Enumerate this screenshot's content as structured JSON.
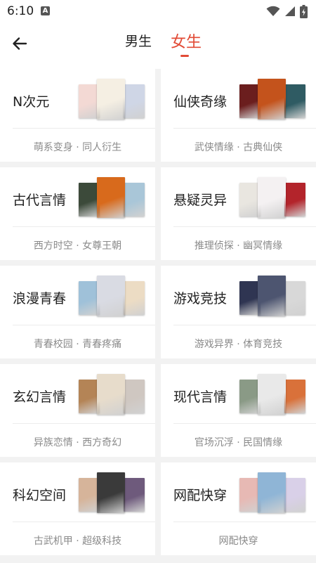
{
  "status": {
    "time": "6:10",
    "notification_icon": "A"
  },
  "header": {
    "tabs": [
      {
        "label": "男生",
        "active": false
      },
      {
        "label": "女生",
        "active": true
      }
    ]
  },
  "accent_color": "#e24b36",
  "categories": [
    {
      "title": "N次元",
      "tags": "萌系变身 · 同人衍生",
      "cover_colors": [
        "#f3d9d4",
        "#f5efe3",
        "#cfd6e6"
      ]
    },
    {
      "title": "仙侠奇缘",
      "tags": "武侠情缘 · 古典仙侠",
      "cover_colors": [
        "#6b1e1e",
        "#c4531c",
        "#2f5b63"
      ]
    },
    {
      "title": "古代言情",
      "tags": "西方时空 · 女尊王朝",
      "cover_colors": [
        "#3c4a3a",
        "#d86a1c",
        "#a9c6d8"
      ]
    },
    {
      "title": "悬疑灵异",
      "tags": "推理侦探 · 幽冥情缘",
      "cover_colors": [
        "#e9e6e0",
        "#f4f1f2",
        "#b3242b"
      ]
    },
    {
      "title": "浪漫青春",
      "tags": "青春校园 · 青春疼痛",
      "cover_colors": [
        "#9fc1d9",
        "#d9dbe3",
        "#ecdcc4"
      ]
    },
    {
      "title": "游戏竞技",
      "tags": "游戏异界 · 体育竞技",
      "cover_colors": [
        "#2f3552",
        "#4d5570",
        "#d8d8d8"
      ]
    },
    {
      "title": "玄幻言情",
      "tags": "异族恋情 · 西方奇幻",
      "cover_colors": [
        "#b48456",
        "#e7dccb",
        "#cfc7c1"
      ]
    },
    {
      "title": "现代言情",
      "tags": "官场沉浮 · 民国情缘",
      "cover_colors": [
        "#8a9a86",
        "#e9e9e9",
        "#d9713a"
      ]
    },
    {
      "title": "科幻空间",
      "tags": "古武机甲 · 超级科技",
      "cover_colors": [
        "#d6b49a",
        "#3a3a3a",
        "#6e5a7c"
      ]
    },
    {
      "title": "网配快穿",
      "tags": "网配快穿",
      "cover_colors": [
        "#e7b9b4",
        "#8fb5d6",
        "#d9d0e8"
      ]
    }
  ]
}
